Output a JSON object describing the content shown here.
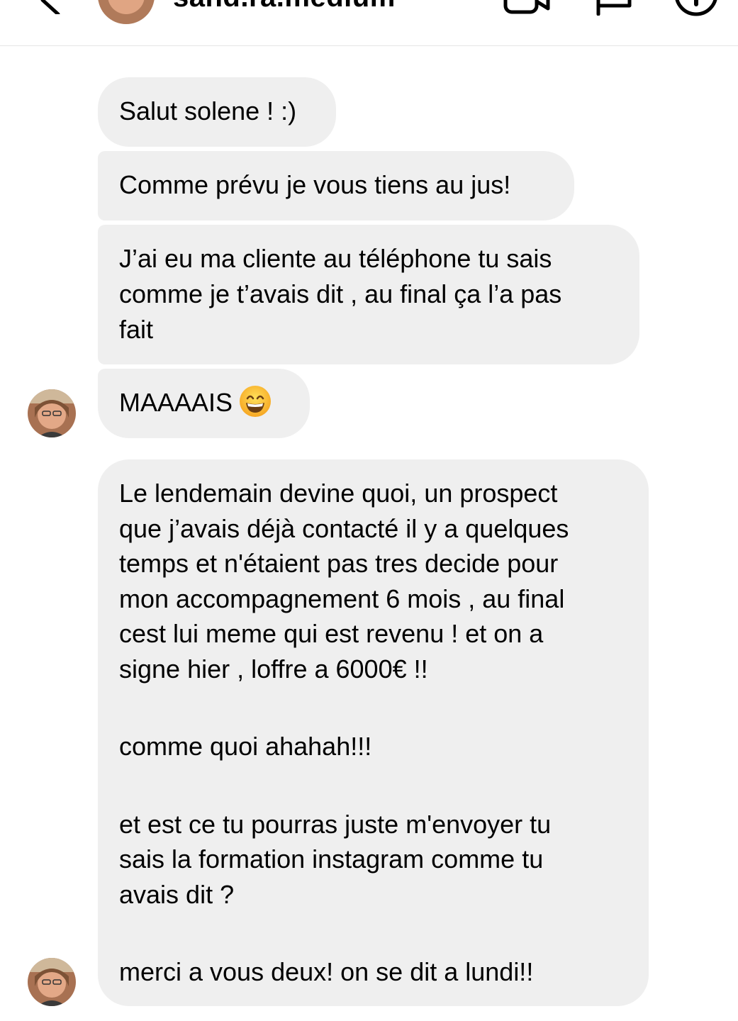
{
  "header": {
    "username": "sand.ra.medium",
    "icons": [
      "back-arrow-icon",
      "video-call-icon",
      "flag-icon",
      "info-icon"
    ]
  },
  "messages": [
    {
      "lines": [
        "Salut solene ! :)"
      ]
    },
    {
      "lines": [
        "Comme prévu je vous tiens au jus!"
      ]
    },
    {
      "lines": [
        "J’ai eu ma cliente au téléphone tu sais",
        "comme je t’avais dit , au final ça l’a pas",
        "fait"
      ]
    },
    {
      "text": "MAAAAIS",
      "emoji": "grinning-face-emoji"
    },
    {
      "paragraphs": [
        [
          "Le lendemain devine quoi, un prospect",
          "que j’avais déjà contacté il y a quelques",
          "temps et n'étaient pas tres decide pour",
          "mon accompagnement 6 mois , au final",
          "cest lui meme qui est revenu ! et on a",
          "signe hier , loffre a 6000€ !!"
        ],
        [
          "comme quoi  ahahah!!!"
        ],
        [
          "et est ce tu pourras juste m'envoyer tu",
          "sais la formation instagram comme tu",
          "avais dit ?"
        ],
        [
          "merci a vous deux! on se dit a lundi!!"
        ]
      ]
    }
  ],
  "colors": {
    "bubble": "#efefef",
    "divider": "#e6e6e6",
    "text": "#000000"
  }
}
